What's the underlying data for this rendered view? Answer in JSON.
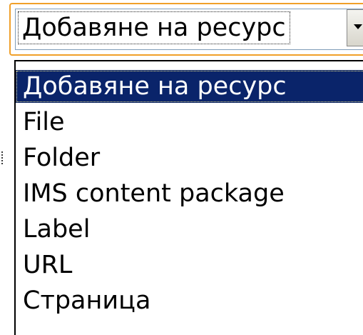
{
  "select": {
    "value": "Добавяне на ресурс",
    "arrow_icon": "chevron-down-icon"
  },
  "dropdown": {
    "options": [
      {
        "label": "Добавяне на ресурс",
        "selected": true
      },
      {
        "label": "File",
        "selected": false
      },
      {
        "label": "Folder",
        "selected": false
      },
      {
        "label": "IMS content package",
        "selected": false
      },
      {
        "label": "Label",
        "selected": false
      },
      {
        "label": "URL",
        "selected": false
      },
      {
        "label": "Страница",
        "selected": false
      }
    ]
  },
  "colors": {
    "focus_border": "#f0a02a",
    "highlight_bg": "#0a246a",
    "highlight_text": "#ffffff"
  }
}
